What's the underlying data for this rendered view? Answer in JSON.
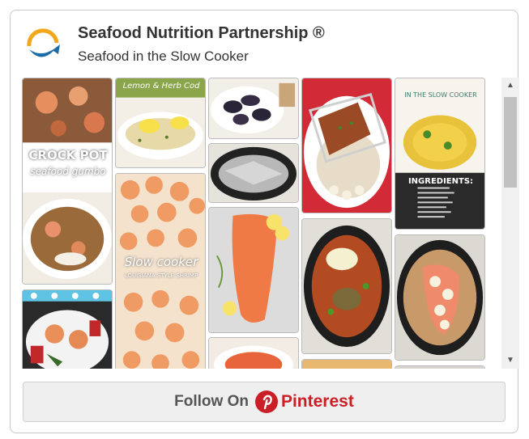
{
  "header": {
    "title": "Seafood Nutrition Partnership ®",
    "subtitle": "Seafood in the Slow Cooker"
  },
  "pins": {
    "gumbo": {
      "line1": "CROCK POT",
      "line2": "seafood gumbo"
    },
    "cod": {
      "caption": "Lemon & Herb Cod"
    },
    "shrimp_boil": {
      "line1": "Slow cooker",
      "line2": "LOUISIANA STYLE SHRIMP"
    },
    "fish_stew": {
      "line1": "IN THE SLOW COOKER",
      "ingredients": "INGREDIENTS:"
    }
  },
  "footer": {
    "follow_label": "Follow On",
    "brand_label": "Pinterest"
  },
  "colors": {
    "pinterest_red": "#cb1f27",
    "title_text": "#333333"
  }
}
